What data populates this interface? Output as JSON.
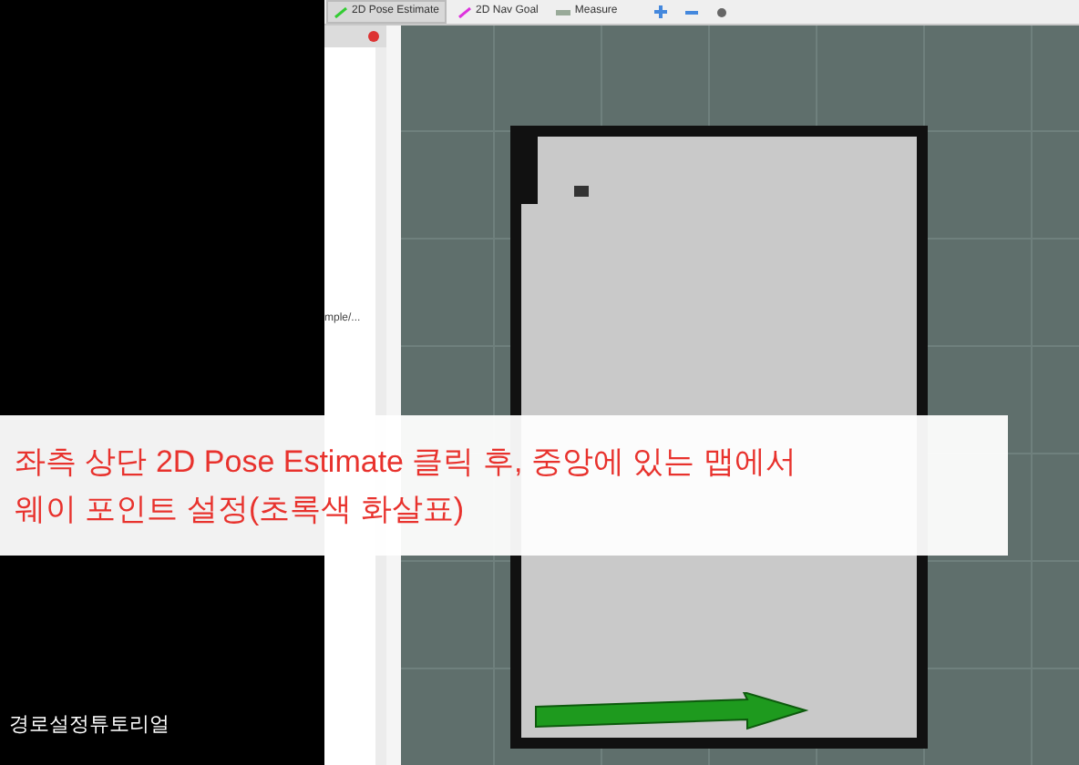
{
  "toolbar": {
    "tools": [
      {
        "label": "2D Pose Estimate",
        "selected": true,
        "kind": "pose"
      },
      {
        "label": "2D Nav Goal",
        "selected": false,
        "kind": "goal"
      },
      {
        "label": "Measure",
        "selected": false,
        "kind": "measure"
      }
    ]
  },
  "side_panel": {
    "path_text": "mple/..."
  },
  "caption": {
    "lines": [
      "좌측 상단 2D Pose Estimate 클릭 후, 중앙에 있는 맵에서",
      "웨이 포인트 설정(초록색 화살표)"
    ]
  },
  "video_title": "경로설정튜토리얼"
}
